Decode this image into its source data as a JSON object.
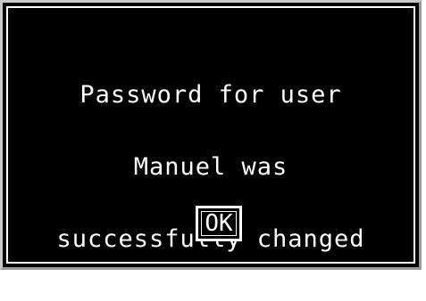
{
  "dialog": {
    "message_lines": [
      "Password for user",
      "Manuel was",
      "successfully changed"
    ],
    "ok_label": "OK"
  },
  "colors": {
    "background": "#000000",
    "text": "#ffffff",
    "border": "#ffffff"
  }
}
